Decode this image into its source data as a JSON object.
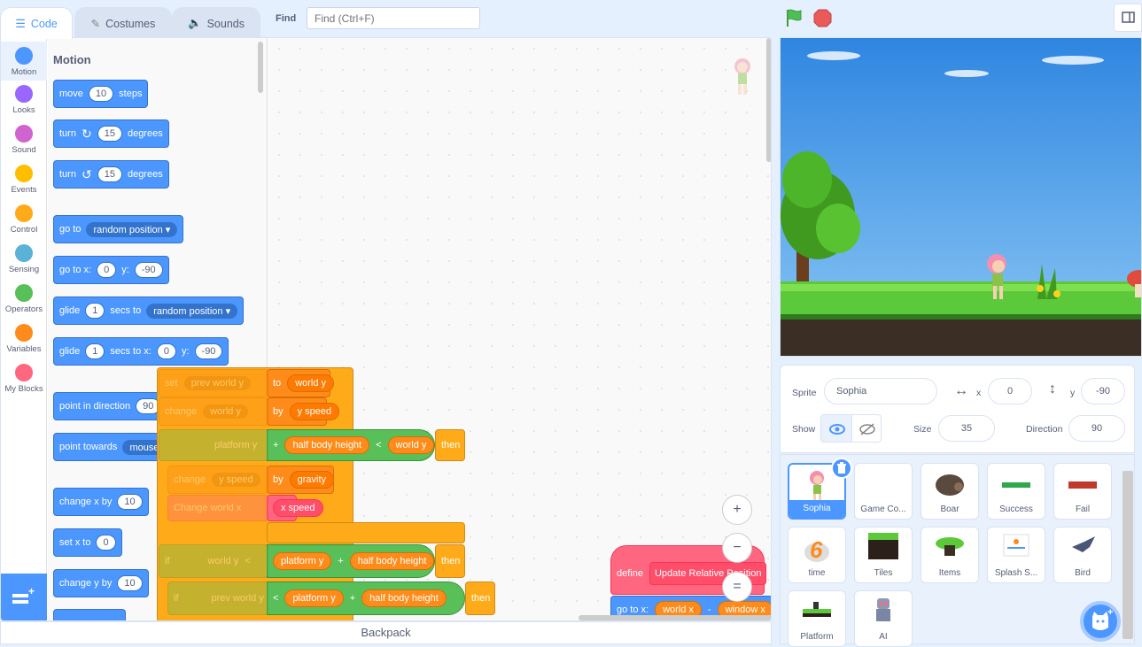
{
  "tabs": {
    "code": "Code",
    "costumes": "Costumes",
    "sounds": "Sounds"
  },
  "find": {
    "label": "Find",
    "placeholder": "Find (Ctrl+F)"
  },
  "categories": [
    {
      "label": "Motion",
      "color": "#4c97ff"
    },
    {
      "label": "Looks",
      "color": "#9966ff"
    },
    {
      "label": "Sound",
      "color": "#cf63cf"
    },
    {
      "label": "Events",
      "color": "#ffbf00"
    },
    {
      "label": "Control",
      "color": "#ffab19"
    },
    {
      "label": "Sensing",
      "color": "#5cb1d6"
    },
    {
      "label": "Operators",
      "color": "#59c059"
    },
    {
      "label": "Variables",
      "color": "#ff8c1a"
    },
    {
      "label": "My Blocks",
      "color": "#ff6680"
    }
  ],
  "palette": {
    "title": "Motion",
    "move": {
      "a": "move",
      "v": "10",
      "b": "steps"
    },
    "turn_right": {
      "a": "turn",
      "v": "15",
      "b": "degrees"
    },
    "turn_left": {
      "a": "turn",
      "v": "15",
      "b": "degrees"
    },
    "goto": {
      "a": "go to",
      "dd": "random position"
    },
    "goto_xy": {
      "a": "go to x:",
      "x": "0",
      "b": "y:",
      "y": "-90"
    },
    "glide": {
      "a": "glide",
      "v": "1",
      "b": "secs to",
      "dd": "random position"
    },
    "glide_xy": {
      "a": "glide",
      "v": "1",
      "b": "secs to x:",
      "x": "0",
      "c": "y:",
      "y": "-90"
    },
    "point_dir": {
      "a": "point in direction",
      "v": "90"
    },
    "point_towards": {
      "a": "point towards",
      "dd": "mouse-pointer"
    },
    "change_x": {
      "a": "change x by",
      "v": "10"
    },
    "set_x": {
      "a": "set x to",
      "v": "0"
    },
    "change_y": {
      "a": "change y by",
      "v": "10"
    }
  },
  "workspace": {
    "set_prev": {
      "a": "set",
      "dd": "prev world y",
      "b": "to",
      "v": "world y"
    },
    "change_world": {
      "a": "change",
      "dd": "world y",
      "b": "by",
      "v": "y speed"
    },
    "if1": {
      "a": "platform y",
      "op": "+",
      "b": "half body height",
      "lt": "<",
      "c": "world y",
      "then": "then"
    },
    "change_yspeed": {
      "a": "change",
      "dd": "y speed",
      "b": "by",
      "v": "gravity"
    },
    "change_worldx": {
      "a": "Change world x",
      "v": "x speed"
    },
    "if2": {
      "if": "if",
      "a": "world y",
      "lt": "<",
      "b": "platform y",
      "op": "+",
      "c": "half body height",
      "then": "then"
    },
    "if3": {
      "if": "if",
      "a": "prev world y",
      "lt": "<",
      "b": "platform y",
      "op": "+",
      "c": "half body height",
      "then": "then"
    },
    "define": {
      "a": "define",
      "b": "Update Relative Position"
    },
    "goto": {
      "a": "go to x:",
      "b": "world x",
      "op": "-",
      "c": "window x"
    }
  },
  "zoom": {
    "in": "+",
    "out": "−",
    "reset": "="
  },
  "backpack": "Backpack",
  "sprite_info": {
    "sprite_label": "Sprite",
    "sprite_name": "Sophia",
    "x_label": "x",
    "x": "0",
    "y_label": "y",
    "y": "-90",
    "show_label": "Show",
    "size_label": "Size",
    "size": "35",
    "direction_label": "Direction",
    "direction": "90"
  },
  "sprites": [
    "Sophia",
    "Game Co...",
    "Boar",
    "Success",
    "Fail",
    "time",
    "Tiles",
    "Items",
    "Splash S...",
    "Bird",
    "Platform",
    "AI"
  ]
}
